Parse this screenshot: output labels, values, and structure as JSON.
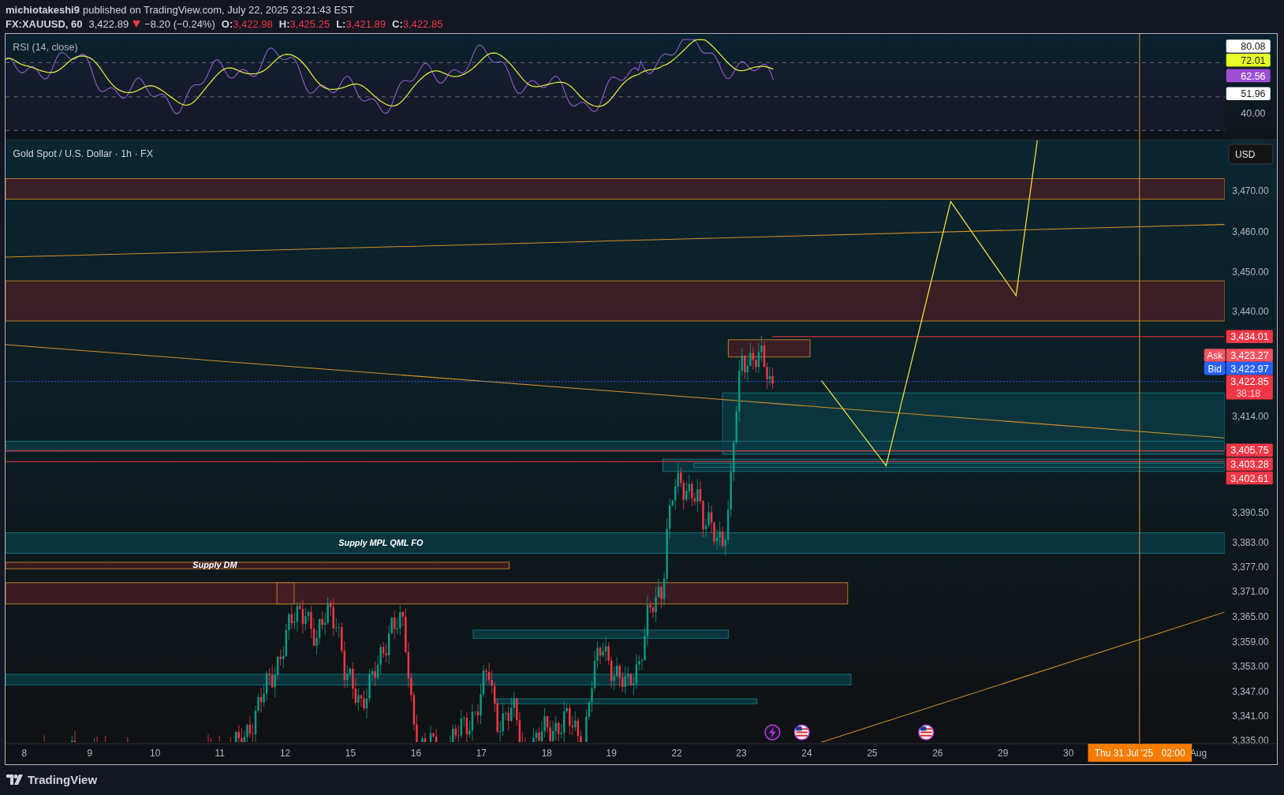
{
  "header": {
    "author": "michiotakeshi9",
    "published": "published on TradingView.com, July 22, 2025 23:21:43 EST",
    "symbol": "FX:XAUUSD, 60",
    "last": "3,422.89",
    "falling": true,
    "change": "−8.20 (−0.24%)",
    "ohlc": [
      {
        "label": "O:",
        "value": "3,422.98"
      },
      {
        "label": "H:",
        "value": "3,425.25"
      },
      {
        "label": "L:",
        "value": "3,421.89"
      },
      {
        "label": "C:",
        "value": "3,422.85"
      }
    ]
  },
  "rsi": {
    "title": "RSI (14, close)",
    "value_labels": [
      {
        "text": "80.08",
        "color": "#ffffff"
      },
      {
        "text": "72.01",
        "color": "#e6ff29"
      },
      {
        "text": "62.56",
        "color": "#9c4fd3"
      },
      {
        "text": "51.96",
        "color": "#ffffff"
      }
    ],
    "ticks": [
      "40.00"
    ]
  },
  "chart": {
    "title": "Gold Spot / U.S. Dollar · 1h · FX",
    "currency": "USD",
    "price_ticks": [
      "3,470.00",
      "3,460.00",
      "3,450.00",
      "3,440.00",
      "3,414.00",
      "3,390.50",
      "3,383.00",
      "3,377.00",
      "3,371.00",
      "3,365.00",
      "3,359.00",
      "3,353.00",
      "3,347.00",
      "3,341.00",
      "3,335.00"
    ],
    "price_markers": [
      {
        "kind": "line",
        "text": "3,434.01"
      },
      {
        "kind": "ask",
        "tag": "Ask",
        "text": "3,423.27"
      },
      {
        "kind": "bid",
        "tag": "Bid",
        "text": "3,422.97"
      },
      {
        "kind": "last",
        "text": "3,422.85",
        "countdown": "38:18"
      },
      {
        "kind": "line",
        "text": "3,405.75"
      },
      {
        "kind": "line",
        "text": "3,403.28"
      },
      {
        "kind": "line",
        "text": "3,402.61"
      }
    ],
    "zone_labels": [
      "Supply MPL QML FO",
      "Supply DM"
    ],
    "time_labels": [
      "8",
      "9",
      "10",
      "11",
      "12",
      "15",
      "16",
      "17",
      "18",
      "19",
      "22",
      "23",
      "24",
      "25",
      "26",
      "29",
      "30",
      "Aug"
    ],
    "crosshair": {
      "date": "Thu 31 Jul '25",
      "time": "02:00"
    }
  },
  "footer": {
    "brand": "TradingView"
  }
}
